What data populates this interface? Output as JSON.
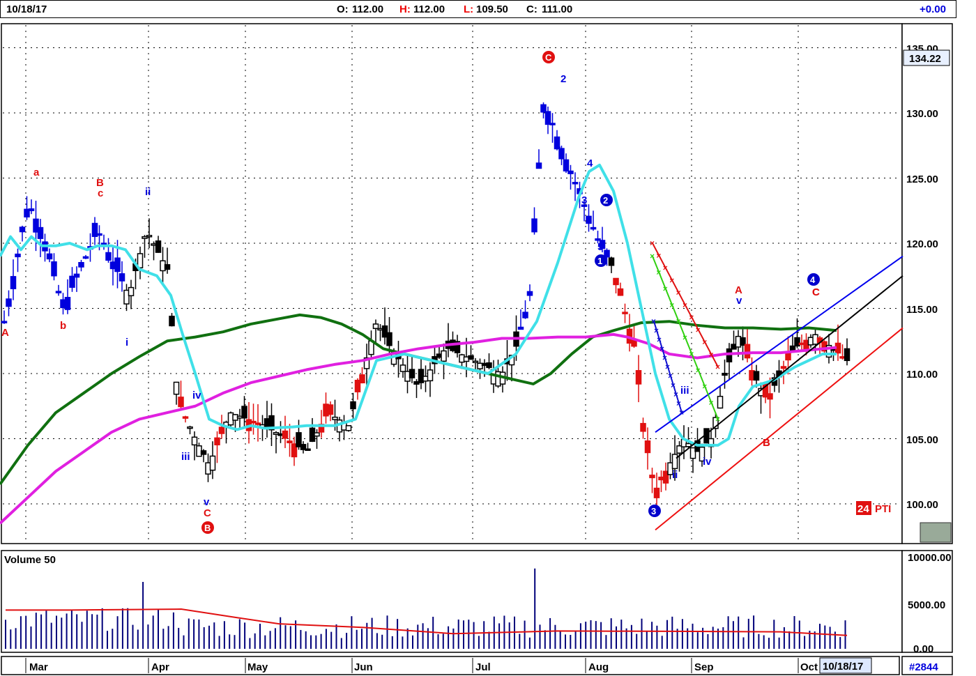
{
  "header": {
    "date": "10/18/17",
    "open_label": "O:",
    "open": "112.00",
    "high_label": "H:",
    "high": "112.00",
    "low_label": "L:",
    "low": "109.50",
    "close_label": "C:",
    "close": "111.00",
    "change": "+0.00"
  },
  "price_axis": {
    "ticks": [
      "135.00",
      "130.00",
      "125.00",
      "120.00",
      "115.00",
      "110.00",
      "105.00",
      "100.00"
    ],
    "last_price": "134.22"
  },
  "volume_panel": {
    "label": "Volume 50",
    "ticks": [
      "10000.00",
      "5000.00",
      "0.00"
    ]
  },
  "time_axis": {
    "months": [
      "Mar",
      "Apr",
      "May",
      "Jun",
      "Jul",
      "Aug",
      "Sep",
      "Oct"
    ],
    "cursor_date": "10/18/17"
  },
  "badge": {
    "number": "24",
    "text": "PTI"
  },
  "footer": {
    "id": "#2844"
  },
  "chart_data": {
    "type": "candlestick",
    "x_range": [
      "Feb 2017",
      "Oct 18 2017"
    ],
    "ylim": [
      97.5,
      137.5
    ],
    "grid": true,
    "series_colors": {
      "ma_cyan": "#40e0e8",
      "ma_magenta": "#e020e0",
      "ma_green": "#107010",
      "up_down_blue": "#0000dd",
      "red": "#e01010",
      "black": "#000000"
    },
    "moving_averages": {
      "cyan": [
        [
          0,
          119
        ],
        [
          15,
          120.5
        ],
        [
          30,
          119.5
        ],
        [
          45,
          120.5
        ],
        [
          60,
          119.8
        ],
        [
          80,
          119.8
        ],
        [
          100,
          120
        ],
        [
          125,
          119.5
        ],
        [
          140,
          119.8
        ],
        [
          160,
          119.8
        ],
        [
          180,
          119.5
        ],
        [
          200,
          118
        ],
        [
          225,
          117.5
        ],
        [
          245,
          116
        ],
        [
          262,
          113
        ],
        [
          280,
          110
        ],
        [
          300,
          106.5
        ],
        [
          320,
          106
        ],
        [
          340,
          105.7
        ],
        [
          360,
          106
        ],
        [
          380,
          105.8
        ],
        [
          420,
          105.9
        ],
        [
          440,
          106
        ],
        [
          480,
          106
        ],
        [
          510,
          106.5
        ],
        [
          540,
          111
        ],
        [
          580,
          111.5
        ],
        [
          620,
          111
        ],
        [
          660,
          110.5
        ],
        [
          700,
          110
        ],
        [
          740,
          111.5
        ],
        [
          770,
          114
        ],
        [
          800,
          118.5
        ],
        [
          830,
          123.5
        ],
        [
          845,
          125.5
        ],
        [
          860,
          126
        ],
        [
          880,
          124
        ],
        [
          900,
          120
        ],
        [
          920,
          115
        ],
        [
          940,
          110
        ],
        [
          960,
          106.5
        ],
        [
          980,
          105
        ],
        [
          1000,
          104.5
        ],
        [
          1030,
          104.5
        ],
        [
          1045,
          105
        ],
        [
          1060,
          107.5
        ],
        [
          1080,
          109
        ],
        [
          1110,
          109.5
        ],
        [
          1140,
          110.5
        ],
        [
          1160,
          111
        ],
        [
          1180,
          111.5
        ],
        [
          1200,
          111.5
        ]
      ],
      "magenta": [
        [
          0,
          98.5
        ],
        [
          40,
          100.5
        ],
        [
          80,
          102.5
        ],
        [
          120,
          104
        ],
        [
          160,
          105.5
        ],
        [
          200,
          106.5
        ],
        [
          240,
          107
        ],
        [
          280,
          107.5
        ],
        [
          320,
          108.5
        ],
        [
          360,
          109.3
        ],
        [
          400,
          109.8
        ],
        [
          440,
          110.3
        ],
        [
          480,
          110.7
        ],
        [
          520,
          111
        ],
        [
          560,
          111.5
        ],
        [
          600,
          111.9
        ],
        [
          640,
          112.2
        ],
        [
          680,
          112.4
        ],
        [
          720,
          112.7
        ],
        [
          760,
          112.7
        ],
        [
          800,
          112.8
        ],
        [
          840,
          112.8
        ],
        [
          860,
          112.9
        ],
        [
          880,
          113
        ],
        [
          900,
          112.8
        ],
        [
          930,
          112.3
        ],
        [
          960,
          111.5
        ],
        [
          1000,
          111.2
        ],
        [
          1040,
          111.5
        ],
        [
          1080,
          111.6
        ],
        [
          1120,
          111.6
        ],
        [
          1160,
          111.8
        ],
        [
          1200,
          112
        ]
      ],
      "green": [
        [
          0,
          101.5
        ],
        [
          40,
          104.5
        ],
        [
          80,
          107
        ],
        [
          120,
          108.5
        ],
        [
          160,
          110
        ],
        [
          200,
          111.3
        ],
        [
          240,
          112.5
        ],
        [
          280,
          112.8
        ],
        [
          320,
          113.2
        ],
        [
          360,
          113.8
        ],
        [
          400,
          114.2
        ],
        [
          430,
          114.5
        ],
        [
          460,
          114.3
        ],
        [
          490,
          113.8
        ],
        [
          520,
          113
        ],
        [
          550,
          111.9
        ],
        [
          580,
          111.5
        ],
        [
          620,
          111
        ],
        [
          660,
          110.5
        ],
        [
          700,
          110
        ],
        [
          740,
          109.5
        ],
        [
          765,
          109.2
        ],
        [
          790,
          110
        ],
        [
          820,
          111.5
        ],
        [
          850,
          112.8
        ],
        [
          880,
          113.3
        ],
        [
          920,
          113.9
        ],
        [
          960,
          114
        ],
        [
          1000,
          113.7
        ],
        [
          1040,
          113.5
        ],
        [
          1080,
          113.5
        ],
        [
          1120,
          113.4
        ],
        [
          1160,
          113.5
        ],
        [
          1200,
          113.3
        ]
      ]
    },
    "trend_lines": [
      {
        "color": "blue",
        "from": [
          940,
          105.5
        ],
        "to": [
          1295,
          119
        ]
      },
      {
        "color": "black",
        "from": [
          970,
          103.5
        ],
        "to": [
          1295,
          117.5
        ]
      },
      {
        "color": "red",
        "from": [
          940,
          98
        ],
        "to": [
          1295,
          113.5
        ]
      }
    ],
    "wave_labels": [
      {
        "text": "a",
        "color": "red"
      },
      {
        "text": "b",
        "color": "red"
      },
      {
        "text": "B",
        "color": "red"
      },
      {
        "text": "c",
        "color": "red"
      },
      {
        "text": "A",
        "color": "red"
      },
      {
        "text": "ii",
        "color": "blue"
      },
      {
        "text": "i",
        "color": "blue"
      },
      {
        "text": "iii",
        "color": "blue"
      },
      {
        "text": "iv",
        "color": "blue"
      },
      {
        "text": "v",
        "color": "blue"
      },
      {
        "text": "C",
        "color": "red"
      },
      {
        "text": "1",
        "color": "blue"
      },
      {
        "text": "2",
        "color": "blue"
      },
      {
        "text": "3",
        "color": "blue"
      },
      {
        "text": "4",
        "color": "blue"
      },
      {
        "text": "5",
        "color": "blue"
      },
      {
        "text": "B",
        "color": "red"
      },
      {
        "text": "C",
        "color": "red"
      },
      {
        "text": "1",
        "color": "blue"
      },
      {
        "text": "2",
        "color": "blue"
      },
      {
        "text": "3",
        "color": "blue"
      },
      {
        "text": "4",
        "color": "blue"
      },
      {
        "text": "ii",
        "color": "blue"
      },
      {
        "text": "iii",
        "color": "blue"
      },
      {
        "text": "iv",
        "color": "blue"
      },
      {
        "text": "A",
        "color": "red"
      },
      {
        "text": "v",
        "color": "blue"
      },
      {
        "text": "B",
        "color": "red"
      },
      {
        "text": "C",
        "color": "red"
      }
    ]
  }
}
